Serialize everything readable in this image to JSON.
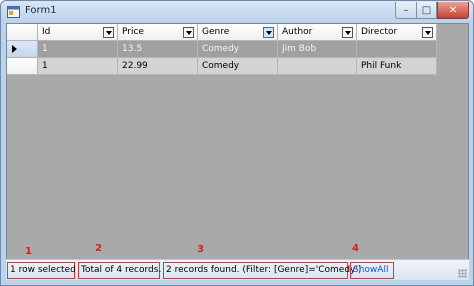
{
  "window": {
    "title": "Form1",
    "controls": {
      "minimize": "–",
      "maximize": "□",
      "close": "✕"
    }
  },
  "grid": {
    "columns": [
      {
        "label": "Id",
        "filter_active": false
      },
      {
        "label": "Price",
        "filter_active": false
      },
      {
        "label": "Genre",
        "filter_active": true
      },
      {
        "label": "Author",
        "filter_active": false
      },
      {
        "label": "Director",
        "filter_active": false
      }
    ],
    "rows": [
      {
        "selected": true,
        "cells": [
          "1",
          "13.5",
          "Comedy",
          "Jim Bob",
          ""
        ]
      },
      {
        "selected": false,
        "cells": [
          "1",
          "22.99",
          "Comedy",
          "",
          "Phil Funk"
        ]
      }
    ]
  },
  "statusbar": {
    "rows_selected": "1 row selected",
    "total_records": "Total of 4 records.",
    "filter_result": "2 records found. (Filter: [Genre]='Comedy')",
    "show_all": "ShowAll"
  },
  "callouts": [
    "1",
    "2",
    "3",
    "4"
  ],
  "colors": {
    "callout": "#d31f1f",
    "link": "#1a4ed8",
    "selected_row": "#a0a0a0",
    "normal_row": "#d3d3d3",
    "grid_background": "#a9a9a9"
  }
}
